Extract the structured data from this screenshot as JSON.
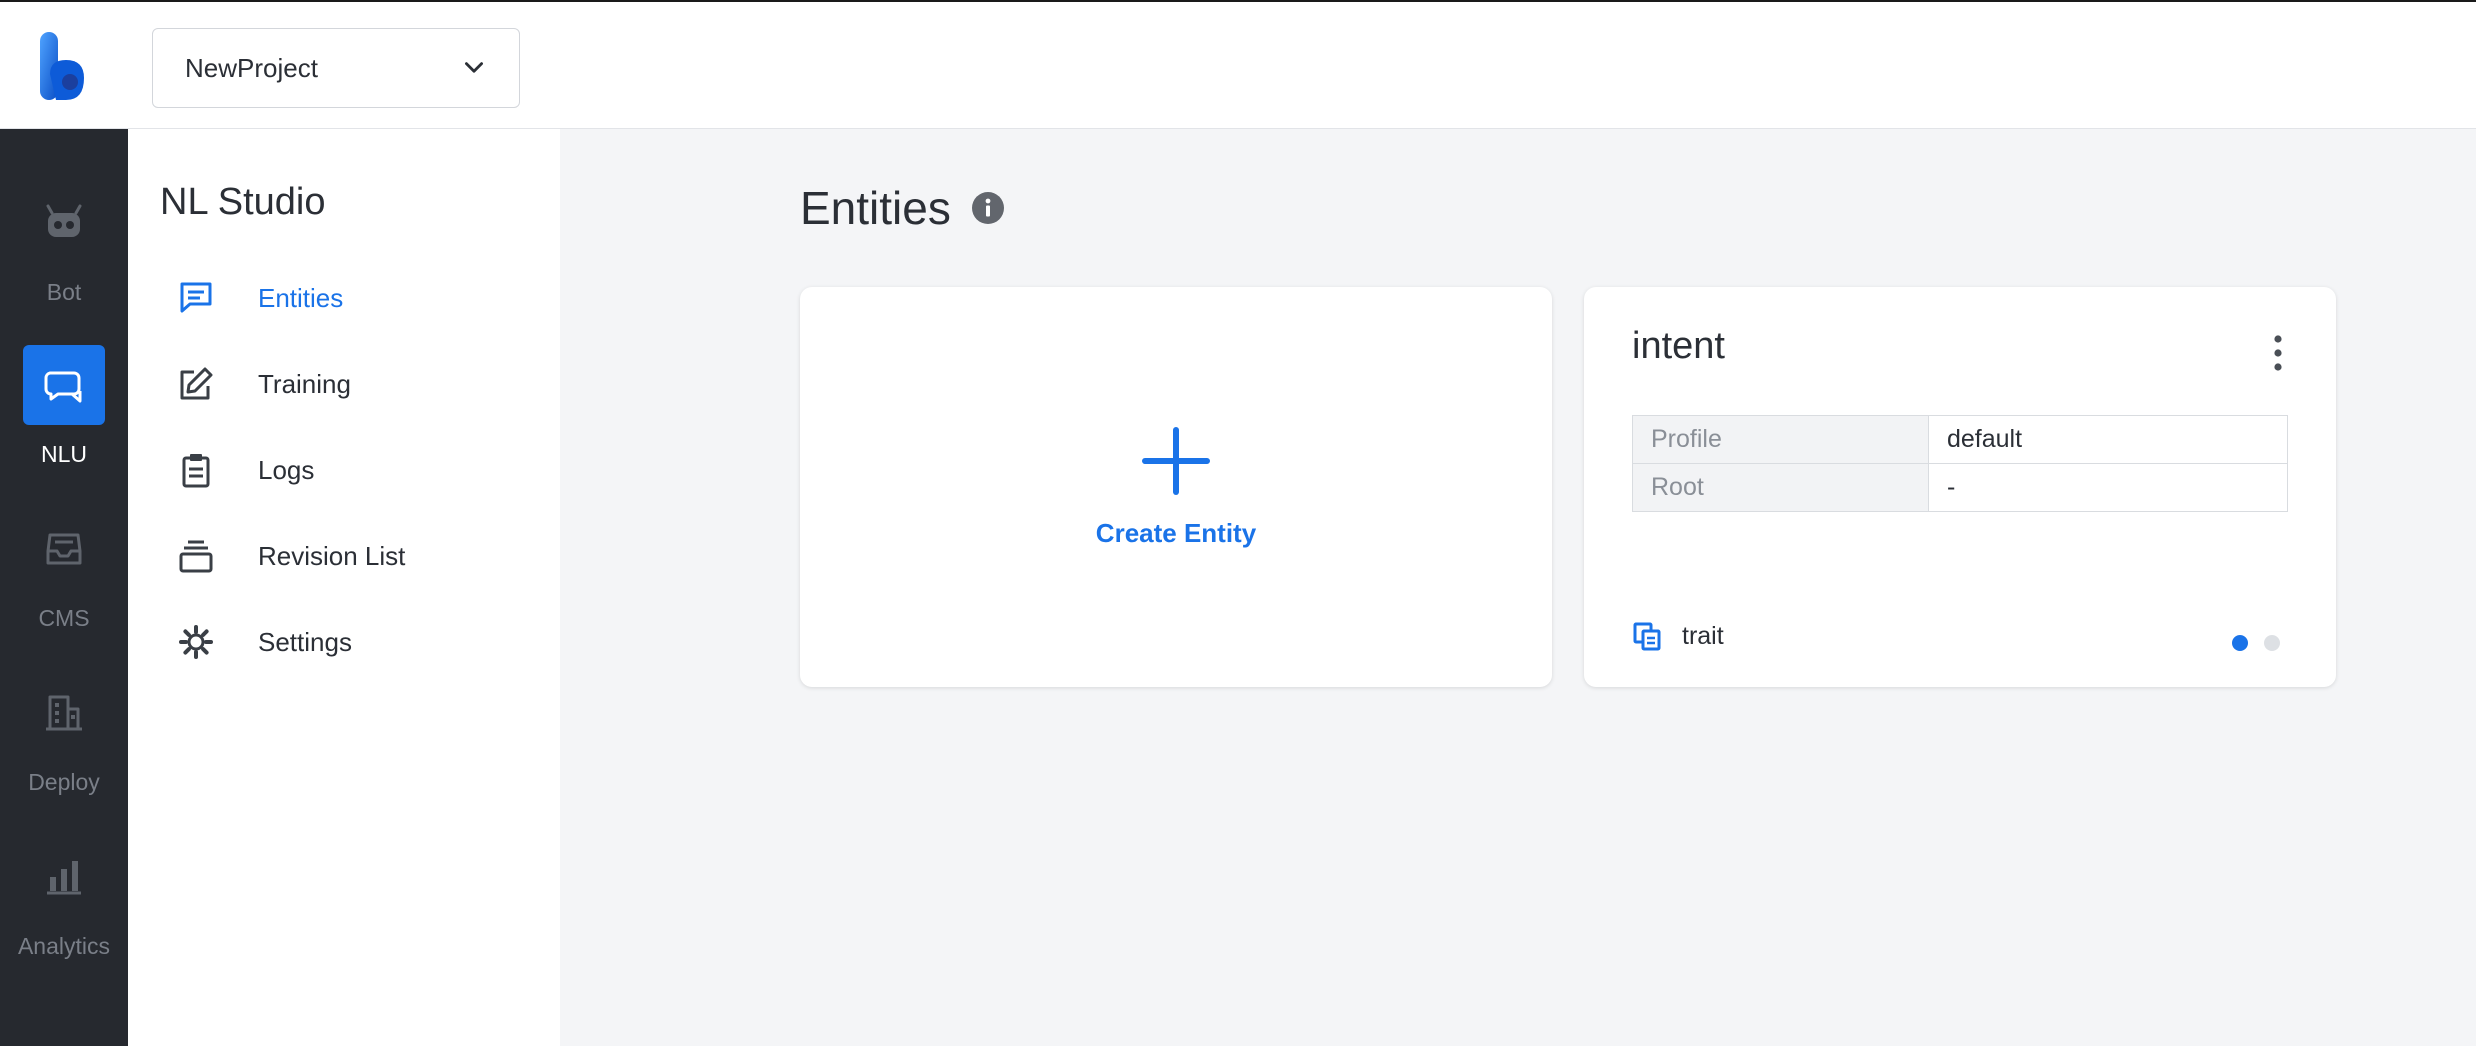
{
  "header": {
    "project_name": "NewProject"
  },
  "rail": {
    "items": [
      {
        "label": "Bot",
        "icon": "robot-icon"
      },
      {
        "label": "NLU",
        "icon": "chat-bubbles-icon",
        "active": true
      },
      {
        "label": "CMS",
        "icon": "inbox-icon"
      },
      {
        "label": "Deploy",
        "icon": "building-icon"
      },
      {
        "label": "Analytics",
        "icon": "bar-chart-icon"
      }
    ]
  },
  "sidenav": {
    "title": "NL Studio",
    "items": [
      {
        "label": "Entities",
        "icon": "message-square-icon",
        "active": true
      },
      {
        "label": "Training",
        "icon": "edit-icon"
      },
      {
        "label": "Logs",
        "icon": "clipboard-icon"
      },
      {
        "label": "Revision List",
        "icon": "layers-icon"
      },
      {
        "label": "Settings",
        "icon": "gear-icon"
      }
    ]
  },
  "main": {
    "page_title": "Entities",
    "create_card": {
      "label": "Create Entity"
    },
    "entity_card": {
      "name": "intent",
      "properties": [
        {
          "key": "Profile",
          "value": "default"
        },
        {
          "key": "Root",
          "value": "-"
        }
      ],
      "trait_label": "trait",
      "pager": {
        "total": 2,
        "current": 1
      }
    }
  },
  "colors": {
    "accent": "#1a73e8",
    "rail_bg": "#26292f",
    "main_bg": "#f4f5f7"
  }
}
